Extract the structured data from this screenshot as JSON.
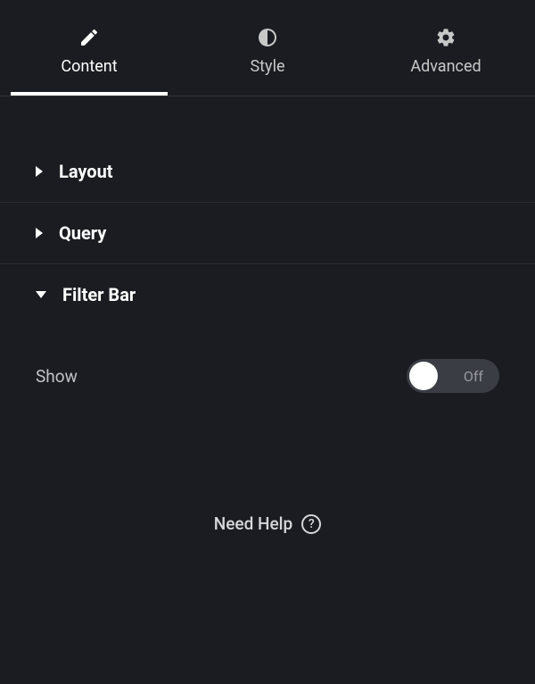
{
  "tabs": {
    "content": {
      "label": "Content",
      "active": true
    },
    "style": {
      "label": "Style",
      "active": false
    },
    "advanced": {
      "label": "Advanced",
      "active": false
    }
  },
  "sections": {
    "layout": {
      "label": "Layout",
      "expanded": false
    },
    "query": {
      "label": "Query",
      "expanded": false
    },
    "filter_bar": {
      "label": "Filter Bar",
      "expanded": true,
      "show": {
        "label": "Show",
        "value": "Off",
        "state": false
      }
    }
  },
  "help": {
    "label": "Need Help",
    "icon_text": "?"
  }
}
